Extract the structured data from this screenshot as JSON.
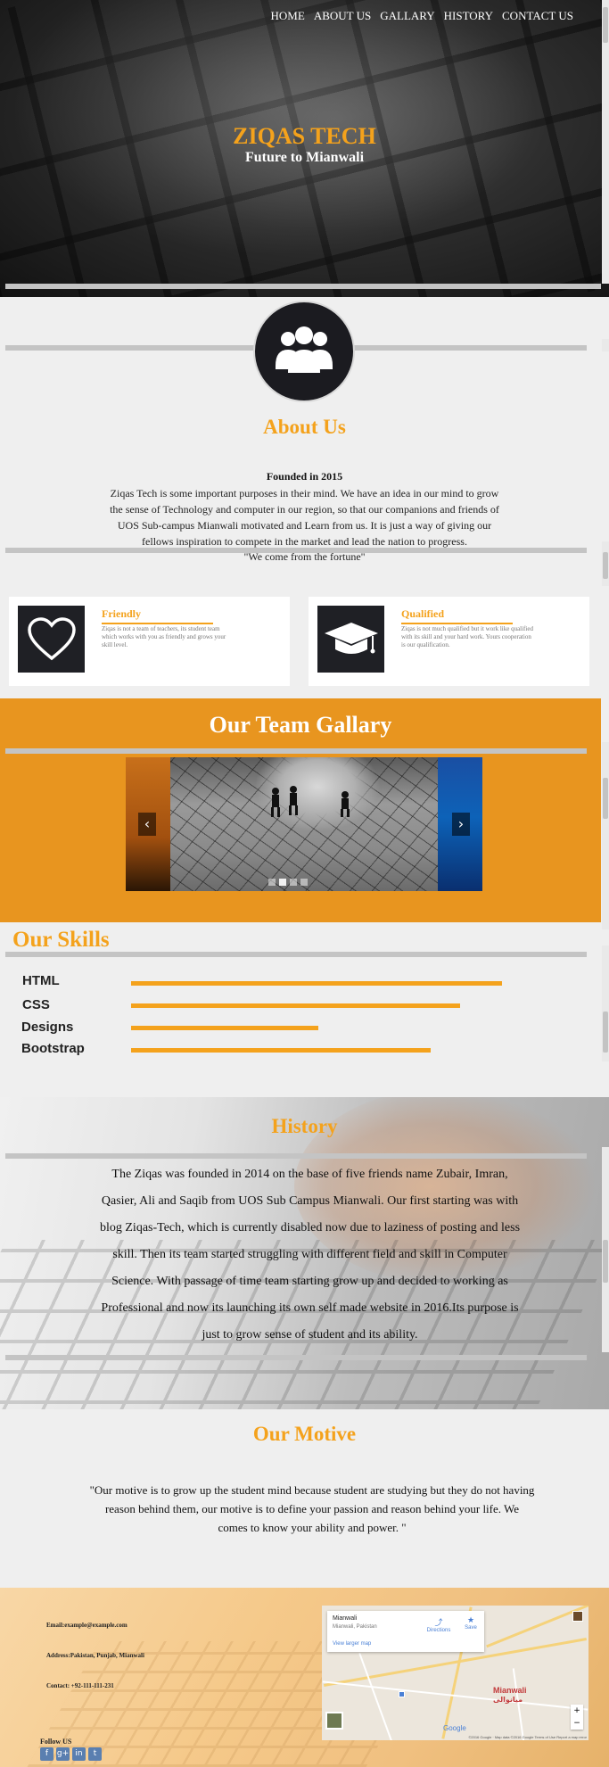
{
  "nav": {
    "items": [
      "HOME",
      "ABOUT US",
      "GALLARY",
      "HISTORY",
      "CONTACT US"
    ]
  },
  "hero": {
    "title": "ZIQAS TECH",
    "subtitle": "Future to Mianwali"
  },
  "about": {
    "title": "About Us",
    "founded": "Founded in 2015",
    "text": "Ziqas Tech is some important purposes in their mind. We have an idea in our mind to grow the sense of Technology and computer in our region, so that our companions and friends of UOS Sub-campus Mianwali motivated and Learn from us. It is just a way of giving our fellows inspiration to compete in the market and lead the nation to progress.",
    "motto": "\"We come from the fortune\""
  },
  "features": [
    {
      "title": "Friendly",
      "desc": "Ziqas is not a team of teachers, its student team which works with you as friendly and grows your skill level.",
      "icon": "heart-icon"
    },
    {
      "title": "Qualified",
      "desc": "Ziqas is not much qualified but it work like qualified with its skill and your hard work. Yours cooperation is our qualification.",
      "icon": "graduation-cap-icon"
    }
  ],
  "gallery": {
    "title": "Our Team Gallary",
    "prev_icon": "‹",
    "next_icon": "›",
    "slides_count": 4,
    "active_slide": 1
  },
  "skills": {
    "title": "Our Skills",
    "items": [
      {
        "label": "HTML",
        "level": 0.89
      },
      {
        "label": "CSS",
        "level": 0.79
      },
      {
        "label": "Designs",
        "level": 0.45
      },
      {
        "label": "Bootstrap",
        "level": 0.72
      }
    ]
  },
  "history": {
    "title": "History",
    "text": "The Ziqas was founded in 2014 on the base of five friends name Zubair, Imran, Qasier, Ali and Saqib from UOS Sub Campus Mianwali. Our first starting was with blog Ziqas-Tech, which is currently disabled now due to laziness of posting and less skill. Then its team started struggling with different field and skill in Computer Science. With passage of time team starting grow up and decided to working as Professional and now its launching its own self made website in 2016.Its purpose is just to grow sense of student and its ability."
  },
  "motive": {
    "title": "Our Motive",
    "text": "\"Our motive is to grow up the student mind because student are studying but they do not having reason behind them, our motive is to define your passion and reason behind your life. We comes to know your ability and power. \""
  },
  "footer": {
    "email": "Email:example@example.com",
    "address": "Address:Pakistan, Punjab, Mianwali",
    "contact": "Contact: +92-111-111-231",
    "follow": "Follow US",
    "social": [
      "f",
      "g+",
      "in",
      "t"
    ]
  },
  "map": {
    "place": "Mianwali",
    "address": "Mianwali, Pakistan",
    "link": "View larger map",
    "directions": "Directions",
    "save": "Save",
    "city_label": "Mianwali",
    "city_label_urdu": "میانوالی",
    "google": "Google",
    "footer": "©2016 Google · Map data ©2016 Google   Terms of Use   Report a map error"
  }
}
